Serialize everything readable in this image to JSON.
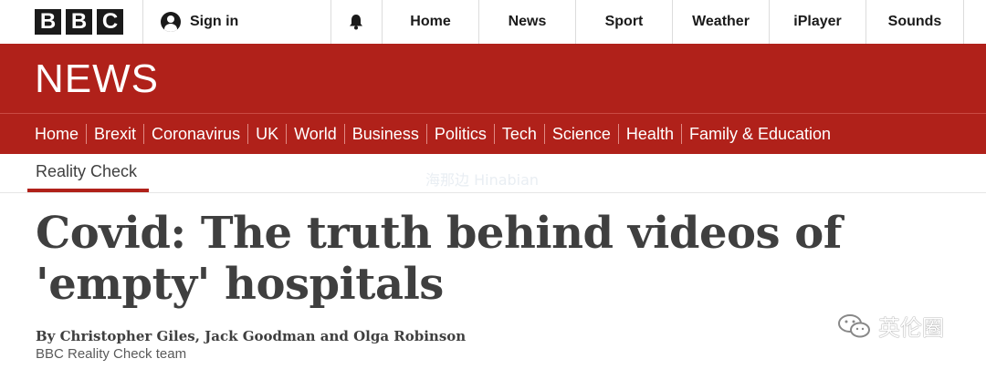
{
  "masthead": {
    "logo_letters": [
      "B",
      "B",
      "C"
    ],
    "signin_label": "Sign in",
    "nav": [
      "Home",
      "News",
      "Sport",
      "Weather",
      "iPlayer",
      "Sounds"
    ]
  },
  "banner": {
    "title": "NEWS"
  },
  "section_nav": [
    "Home",
    "Brexit",
    "Coronavirus",
    "UK",
    "World",
    "Business",
    "Politics",
    "Tech",
    "Science",
    "Health",
    "Family & Education"
  ],
  "article": {
    "category": "Reality Check",
    "headline": "Covid: The truth behind videos of 'empty' hospitals",
    "byline": "By Christopher Giles, Jack Goodman and Olga Robinson",
    "team": "BBC Reality Check team"
  },
  "watermark": {
    "text": "英伦圈",
    "logo_text": "海那边 Hinabian"
  },
  "colors": {
    "brand_red": "#b0211a",
    "text_dark": "#3f3f3f"
  }
}
